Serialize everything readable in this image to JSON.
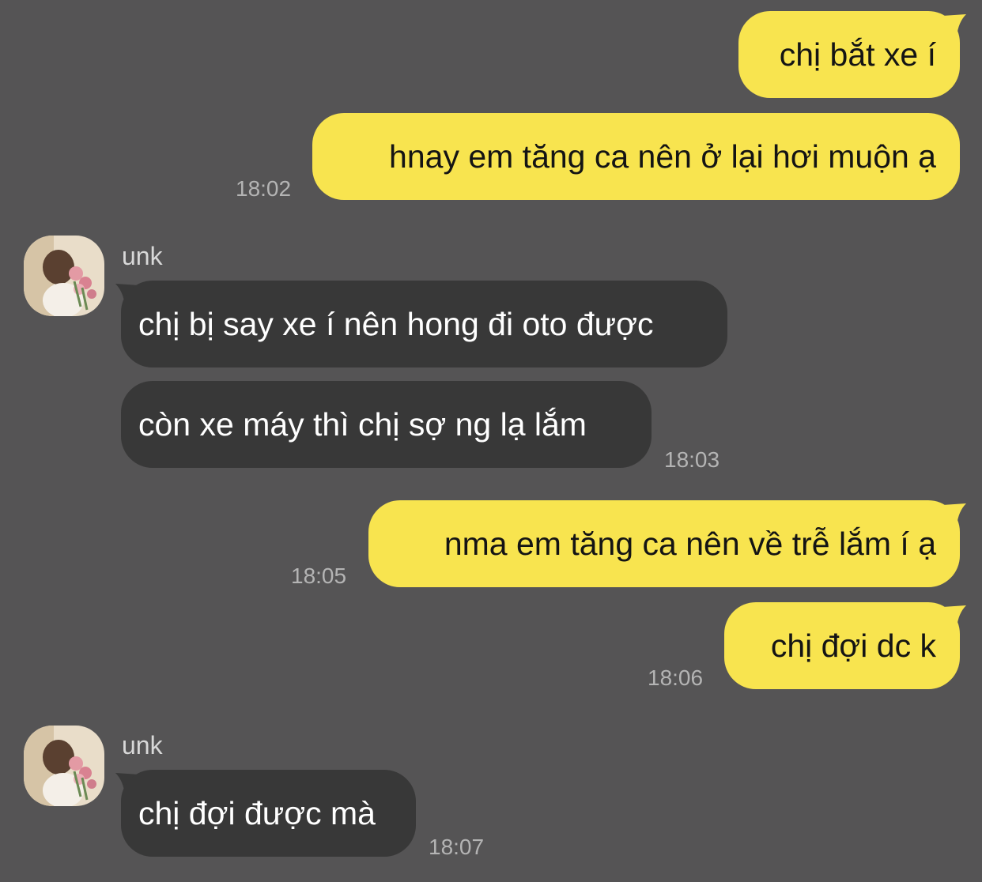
{
  "messages": [
    {
      "side": "out",
      "text": "chị bắt xe í",
      "time": ""
    },
    {
      "side": "out",
      "text": "hnay em tăng ca nên ở lại hơi muộn ạ",
      "time": "18:02"
    },
    {
      "side": "in",
      "sender": "unk",
      "text": "chị bị say xe í nên hong đi oto được",
      "time": ""
    },
    {
      "side": "in",
      "text": "còn xe máy thì chị sợ ng lạ lắm",
      "time": "18:03"
    },
    {
      "side": "out",
      "text": "nma em tăng ca nên về trễ lắm í ạ",
      "time": "18:05"
    },
    {
      "side": "out",
      "text": "chị đợi dc k",
      "time": "18:06"
    },
    {
      "side": "in",
      "sender": "unk",
      "text": "chị đợi được mà",
      "time": "18:07"
    }
  ],
  "colors": {
    "background": "#555455",
    "outgoing_bubble": "#f8e44f",
    "incoming_bubble": "#383838"
  },
  "icons": {
    "avatar": "profile-photo-woman-with-flowers-icon"
  }
}
